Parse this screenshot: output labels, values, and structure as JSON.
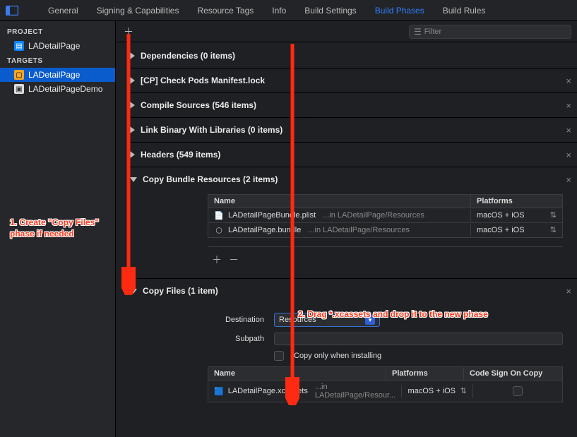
{
  "tabs": {
    "general": "General",
    "signing": "Signing & Capabilities",
    "resource": "Resource Tags",
    "info": "Info",
    "build_settings": "Build Settings",
    "build_phases": "Build Phases",
    "build_rules": "Build Rules"
  },
  "sidebar": {
    "project_heading": "PROJECT",
    "targets_heading": "TARGETS",
    "project_name": "LADetailPage",
    "targets": [
      {
        "label": "LADetailPage",
        "selected": true,
        "icon": "frame"
      },
      {
        "label": "LADetailPageDemo",
        "selected": false,
        "icon": "app"
      }
    ]
  },
  "filter": {
    "placeholder": "Filter"
  },
  "phases": {
    "deps": "Dependencies (0 items)",
    "cp_pods": "[CP] Check Pods Manifest.lock",
    "compile": "Compile Sources (546 items)",
    "link": "Link Binary With Libraries (0 items)",
    "headers": "Headers (549 items)",
    "copy_bundle": "Copy Bundle Resources (2 items)",
    "copy_files": "Copy Files (1 item)"
  },
  "copy_bundle": {
    "col_name": "Name",
    "col_plat": "Platforms",
    "rows": [
      {
        "file": "LADetailPageBundle.plist",
        "path": "...in LADetailPage/Resources",
        "platforms": "macOS + iOS",
        "icon": "doc"
      },
      {
        "file": "LADetailPage.bundle",
        "path": "...in LADetailPage/Resources",
        "platforms": "macOS + iOS",
        "icon": "bundle"
      }
    ]
  },
  "copy_files_form": {
    "dest_label": "Destination",
    "dest_value": "Resources",
    "subpath_label": "Subpath",
    "copy_only_label": "Copy only when installing"
  },
  "copy_files_table": {
    "col_name": "Name",
    "col_plat": "Platforms",
    "col_sign": "Code Sign On Copy",
    "rows": [
      {
        "file": "LADetailPage.xcassets",
        "path": "...in LADetailPage/Resour...",
        "platforms": "macOS + iOS"
      }
    ]
  },
  "annot": {
    "step1_l1": "1. Create \"Copy Files\"",
    "step1_l2": "phase if needed",
    "step2": "2. Drag *.xcassets and drop it to the new phase"
  }
}
